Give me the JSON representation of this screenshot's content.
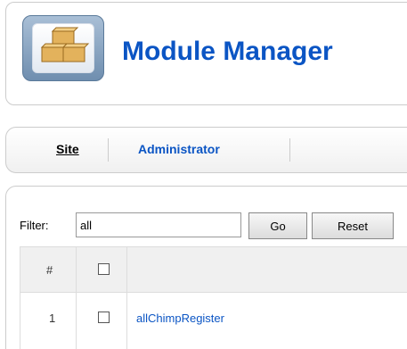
{
  "header": {
    "title": "Module Manager"
  },
  "submenu": {
    "tabs": [
      {
        "label": "Site",
        "active": true
      },
      {
        "label": "Administrator",
        "active": false
      }
    ]
  },
  "filter": {
    "label": "Filter:",
    "value": "all",
    "go_label": "Go",
    "reset_label": "Reset"
  },
  "table": {
    "columns": [
      "#",
      ""
    ],
    "rows": [
      {
        "number": "1",
        "name": "allChimpRegister",
        "checked": false
      }
    ]
  },
  "colors": {
    "accent": "#0b55c4",
    "border": "#cccccc",
    "header_bg": "#f0f0f0"
  },
  "icons": {
    "header_icon": "module-boxes-icon"
  }
}
